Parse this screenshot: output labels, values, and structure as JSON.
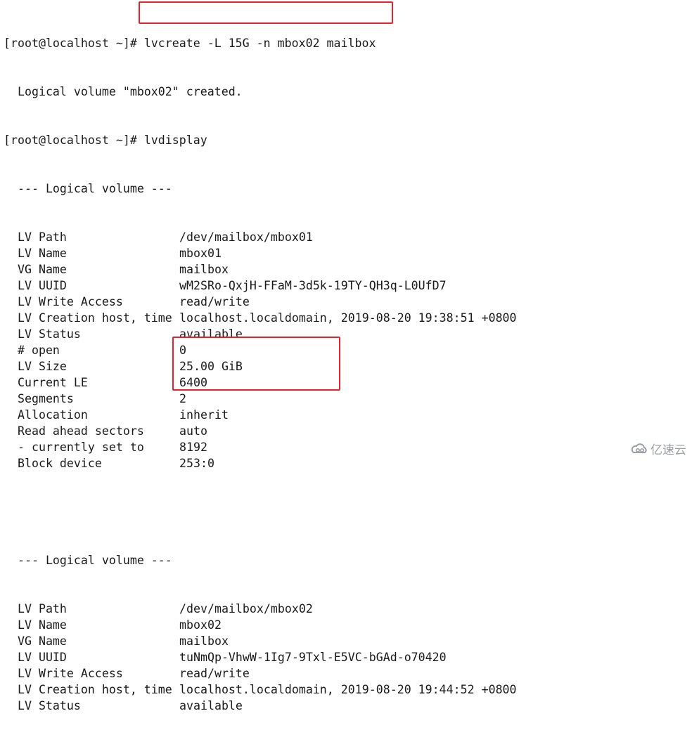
{
  "terminal": {
    "prompt": "[root@localhost ~]# ",
    "cmd1": "lvcreate -L 15G -n mbox02 mailbox",
    "out1": "  Logical volume \"mbox02\" created.",
    "cmd2": "lvdisplay",
    "header": "  --- Logical volume ---",
    "lv1": [
      {
        "k": "  LV Path",
        "v": "/dev/mailbox/mbox01"
      },
      {
        "k": "  LV Name",
        "v": "mbox01"
      },
      {
        "k": "  VG Name",
        "v": "mailbox"
      },
      {
        "k": "  LV UUID",
        "v": "wM2SRo-QxjH-FFaM-3d5k-19TY-QH3q-L0UfD7"
      },
      {
        "k": "  LV Write Access",
        "v": "read/write"
      },
      {
        "k": "  LV Creation host, time",
        "v": "localhost.localdomain, 2019-08-20 19:38:51 +0800"
      },
      {
        "k": "  LV Status",
        "v": "available"
      },
      {
        "k": "  # open",
        "v": "0"
      },
      {
        "k": "  LV Size",
        "v": "25.00 GiB"
      },
      {
        "k": "  Current LE",
        "v": "6400"
      },
      {
        "k": "  Segments",
        "v": "2"
      },
      {
        "k": "  Allocation",
        "v": "inherit"
      },
      {
        "k": "  Read ahead sectors",
        "v": "auto"
      },
      {
        "k": "  - currently set to",
        "v": "8192"
      },
      {
        "k": "  Block device",
        "v": "253:0"
      }
    ],
    "lv2": [
      {
        "k": "  LV Path",
        "v": "/dev/mailbox/mbox02"
      },
      {
        "k": "  LV Name",
        "v": "mbox02"
      },
      {
        "k": "  VG Name",
        "v": "mailbox"
      },
      {
        "k": "  LV UUID",
        "v": "tuNmQp-VhwW-1Ig7-9Txl-E5VC-bGAd-o70420"
      },
      {
        "k": "  LV Write Access",
        "v": "read/write"
      },
      {
        "k": "  LV Creation host, time",
        "v": "localhost.localdomain, 2019-08-20 19:44:52 +0800"
      },
      {
        "k": "  LV Status",
        "v": "available"
      }
    ]
  },
  "watermark": {
    "text": "亿速云",
    "icon": "cloud-logo-icon"
  },
  "colors": {
    "highlight": "#e8222b",
    "text": "#1a1a1a",
    "watermark": "#9a9ea6"
  }
}
